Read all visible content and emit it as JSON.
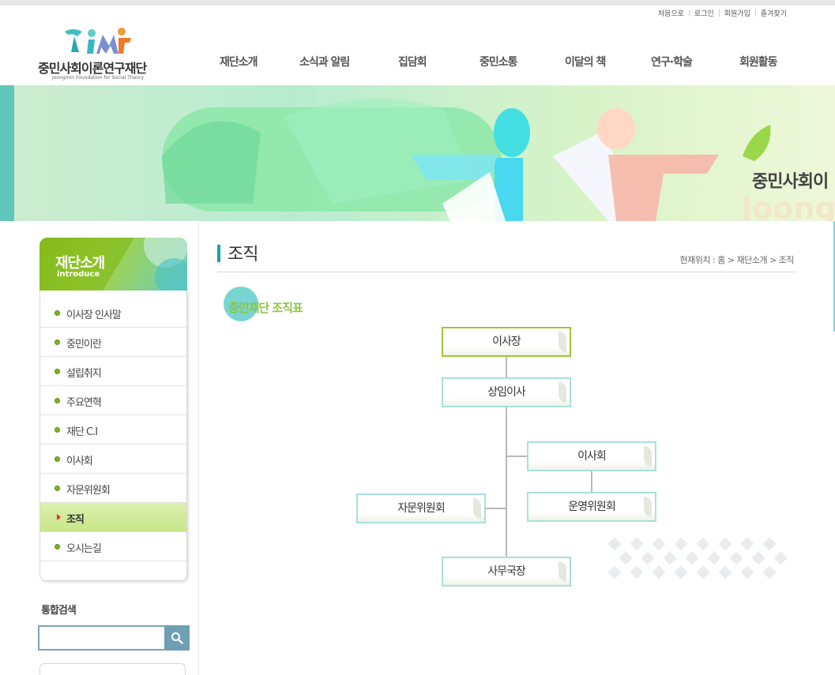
{
  "util_links": [
    "처음으로",
    "로그인",
    "회원가입",
    "즐겨찾기"
  ],
  "logo": {
    "name": "중민사회이론연구재단",
    "sub": "Joongmin Foundation for Social Theory"
  },
  "gnb": [
    "재단소개",
    "소식과 알림",
    "집담회",
    "중민소통",
    "이달의 책",
    "연구·학술",
    "회원활동"
  ],
  "banner": {
    "text": "중민사회이",
    "eng": "Joong"
  },
  "lnb": {
    "title": "재단소개",
    "eng": "introduce",
    "items": [
      "이사장 인사말",
      "중민이란",
      "설립취지",
      "주요연혁",
      "재단 C.I",
      "이사회",
      "자문위원회",
      "조직",
      "오시는길"
    ],
    "active_index": 7
  },
  "search": {
    "title": "통합검색",
    "value": ""
  },
  "page": {
    "title": "조직",
    "breadcrumb": "현재위치 : 홈 > 재단소개 > 조직",
    "section_title": "중민재단 조직표"
  },
  "org_chart": {
    "chairman": "이사장",
    "standing_director": "상임이사",
    "board": "이사회",
    "operating_committee": "운영위원회",
    "advisory_committee": "자문위원회",
    "secretary_general": "사무국장"
  },
  "colors": {
    "accent_green": "#8cc63f",
    "accent_teal": "#1aa3a8",
    "box_border": "#a8e0de",
    "search_btn": "#6f9fb2"
  }
}
